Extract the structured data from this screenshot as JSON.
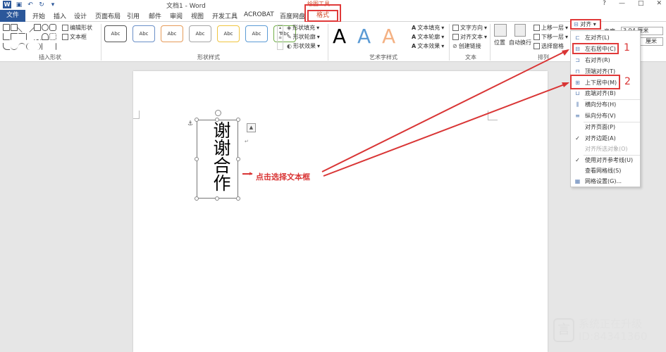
{
  "titlebar": {
    "doc_title": "文档1 - Word",
    "context_title": "绘图工具",
    "help_btn": "?",
    "min_btn": "—",
    "max_btn": "□",
    "close_btn": "✕"
  },
  "tabs": {
    "file": "文件",
    "items": [
      "开始",
      "插入",
      "设计",
      "页面布局",
      "引用",
      "邮件",
      "审阅",
      "视图",
      "开发工具",
      "ACROBAT",
      "百度网盘"
    ],
    "format": "格式"
  },
  "ribbon": {
    "insert_shapes": {
      "edit_shape": "编辑形状",
      "text_box": "文本框",
      "label": "插入形状"
    },
    "shape_styles": {
      "gallery_item": "Abc",
      "fill": "形状填充",
      "outline": "形状轮廓",
      "effects": "形状效果",
      "label": "形状样式"
    },
    "wordart": {
      "letter": "A",
      "text_fill": "文本填充",
      "text_outline": "文本轮廓",
      "text_effects": "文本效果",
      "label": "艺术字样式"
    },
    "text": {
      "direction": "文字方向",
      "align_text": "对齐文本",
      "create_link": "创建链接",
      "label": "文本"
    },
    "arrange": {
      "position": "位置",
      "wrap": "自动换行",
      "bring_forward": "上移一层",
      "send_backward": "下移一层",
      "selection_pane": "选择窗格",
      "align": "对齐",
      "label": "排列"
    },
    "size": {
      "height_label": "高度:",
      "height_value": "3.94 厘米",
      "width_value": "厘米"
    }
  },
  "document": {
    "textbox_text": "谢谢合作",
    "annotation": "点击选择文本框"
  },
  "align_menu": {
    "items": [
      {
        "label": "左对齐(L)",
        "icon": "align-left-icon",
        "glyph": "⊏",
        "disabled": false
      },
      {
        "label": "左右居中(C)",
        "icon": "align-center-icon",
        "glyph": "⊟",
        "disabled": false
      },
      {
        "label": "右对齐(R)",
        "icon": "align-right-icon",
        "glyph": "⊐",
        "disabled": false
      },
      {
        "label": "顶端对齐(T)",
        "icon": "align-top-icon",
        "glyph": "⊓",
        "disabled": false
      },
      {
        "label": "上下居中(M)",
        "icon": "align-middle-icon",
        "glyph": "⊞",
        "disabled": false
      },
      {
        "label": "底端对齐(B)",
        "icon": "align-bottom-icon",
        "glyph": "⊔",
        "disabled": false
      },
      {
        "label": "横向分布(H)",
        "icon": "distribute-horizontal-icon",
        "glyph": "⫼",
        "disabled": false
      },
      {
        "label": "纵向分布(V)",
        "icon": "distribute-vertical-icon",
        "glyph": "≡",
        "disabled": false
      },
      {
        "label": "对齐页面(P)",
        "icon": "",
        "glyph": "",
        "disabled": false
      },
      {
        "label": "对齐边距(A)",
        "icon": "checkmark-icon",
        "glyph": "✓",
        "disabled": false
      },
      {
        "label": "对齐所选对象(O)",
        "icon": "",
        "glyph": "",
        "disabled": true
      },
      {
        "label": "使用对齐参考线(U)",
        "icon": "checkmark-icon",
        "glyph": "✓",
        "disabled": false
      },
      {
        "label": "查看网格线(S)",
        "icon": "",
        "glyph": "",
        "disabled": false
      },
      {
        "label": "网格设置(G)...",
        "icon": "grid-settings-icon",
        "glyph": "▦",
        "disabled": false
      }
    ]
  },
  "callouts": {
    "num1": "1",
    "num2": "2"
  },
  "watermark": {
    "line1": "系统正在升级",
    "line2": "ID:84341360"
  },
  "colors": {
    "accent": "#2b579a",
    "highlight": "#e03a3a",
    "annotation": "#d93535"
  }
}
